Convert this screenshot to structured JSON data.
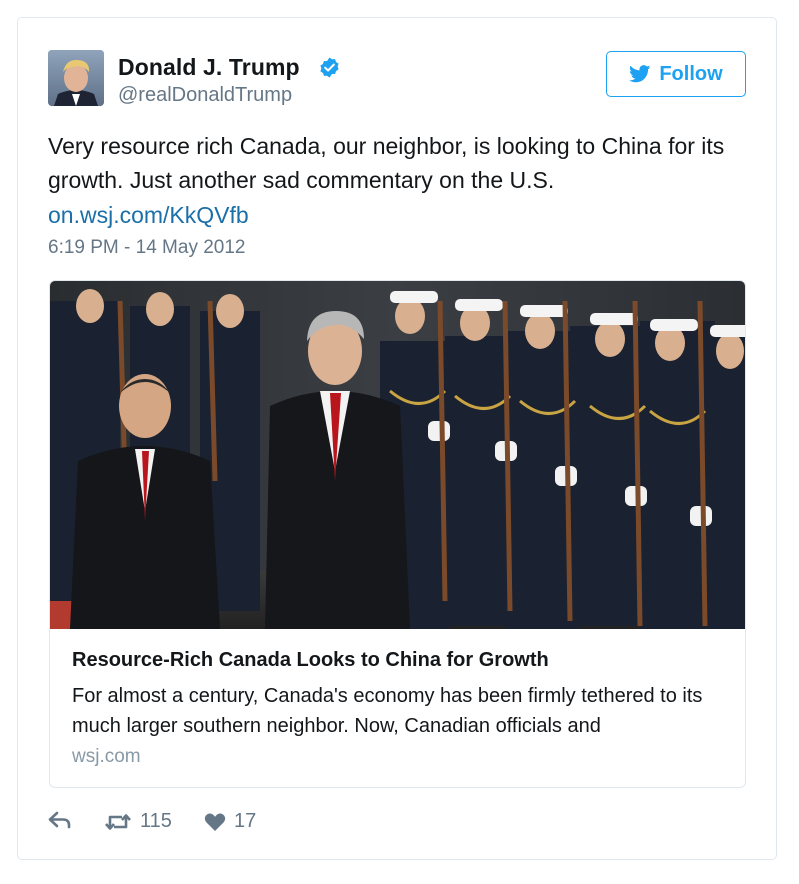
{
  "author": {
    "name": "Donald J. Trump",
    "handle": "@realDonaldTrump",
    "verified": true
  },
  "follow_button": {
    "label": "Follow",
    "icon": "twitter-bird-icon"
  },
  "tweet": {
    "text": "Very resource rich Canada, our neighbor, is looking to China for its growth. Just another sad commentary on the U.S.",
    "link": "on.wsj.com/KkQVfb",
    "timestamp": "6:19 PM - 14 May 2012"
  },
  "card": {
    "title": "Resource-Rich Canada Looks to China for Growth",
    "description": "For almost a century, Canada's economy has been firmly tethered to its much larger southern neighbor. Now, Canadian officials and",
    "domain": "wsj.com"
  },
  "actions": {
    "reply_icon": "reply-icon",
    "retweet_icon": "retweet-icon",
    "retweet_count": "115",
    "like_icon": "heart-icon",
    "like_count": "17"
  },
  "colors": {
    "accent": "#1da1f2",
    "link": "#1b6fa8",
    "secondary_text": "#657786",
    "border": "#e1e8ed"
  }
}
